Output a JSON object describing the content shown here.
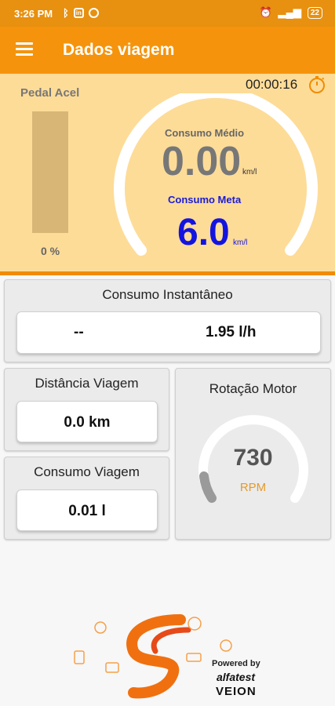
{
  "status_bar": {
    "time": "3:26 PM",
    "battery": "22"
  },
  "app_bar": {
    "title": "Dados viagem"
  },
  "top_panel": {
    "pedal_label": "Pedal Acel",
    "pedal_value": "0 %",
    "pedal_fraction": 0,
    "timer": "00:00:16",
    "consumo_medio_label": "Consumo Médio",
    "consumo_medio_value": "0.00",
    "consumo_medio_unit": "km/l",
    "consumo_meta_label": "Consumo Meta",
    "consumo_meta_value": "6.0",
    "consumo_meta_unit": "km/l"
  },
  "instant_card": {
    "title": "Consumo Instantâneo",
    "left_value": "--",
    "right_value": "1.95 l/h"
  },
  "distance_card": {
    "title": "Distância Viagem",
    "value": "0.0 km"
  },
  "trip_consumption_card": {
    "title": "Consumo Viagem",
    "value": "0.01 l"
  },
  "rpm_card": {
    "title": "Rotação Motor",
    "value": "730",
    "unit": "RPM"
  },
  "footer": {
    "powered_by": "Powered by",
    "brand1": "alfatest",
    "brand2": "VEION"
  },
  "colors": {
    "status_bar": "#e8900f",
    "app_bar": "#f5940c",
    "panel": "#fddc98",
    "accent": "#f28b00",
    "meta_blue": "#1414e0"
  },
  "icons": [
    "menu-icon",
    "stopwatch-icon",
    "bluetooth-icon",
    "linkedin-icon",
    "whatsapp-icon",
    "alarm-icon",
    "signal-icon",
    "battery-icon"
  ]
}
